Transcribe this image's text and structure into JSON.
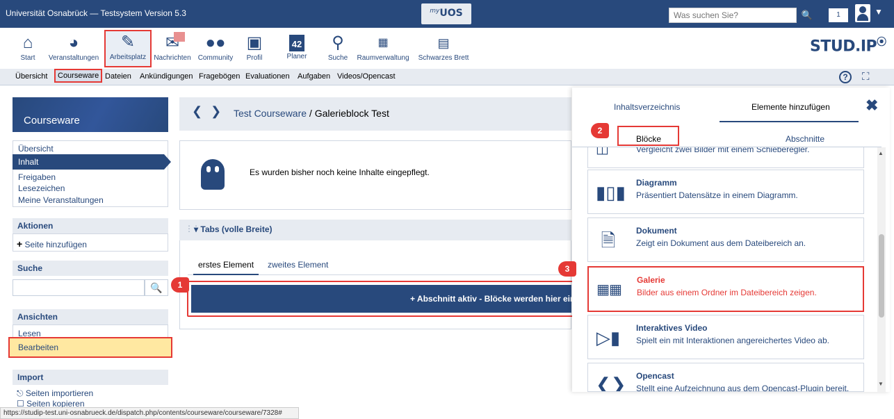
{
  "topbar": {
    "title": "Universität Osnabrück — Testsystem Version 5.3",
    "myuos_prefix": "my",
    "myuos_label": "UOS",
    "search_placeholder": "Was suchen Sie?",
    "counter": "1"
  },
  "nav": {
    "items": [
      {
        "label": "Start",
        "icon": "home-icon"
      },
      {
        "label": "Veranstaltungen",
        "icon": "courses-icon"
      },
      {
        "label": "Arbeitsplatz",
        "icon": "workplace-icon"
      },
      {
        "label": "Nachrichten",
        "icon": "mail-icon"
      },
      {
        "label": "Community",
        "icon": "community-icon"
      },
      {
        "label": "Profil",
        "icon": "profile-icon"
      },
      {
        "label": "Planer",
        "icon": "calendar-icon",
        "badge": "42"
      },
      {
        "label": "Suche",
        "icon": "search-icon"
      },
      {
        "label": "Raumverwaltung",
        "icon": "rooms-icon"
      },
      {
        "label": "Schwarzes Brett",
        "icon": "board-icon"
      }
    ],
    "logo": "STUD.IP"
  },
  "subnav": {
    "items": [
      "Übersicht",
      "Courseware",
      "Dateien",
      "Ankündigungen",
      "Fragebögen",
      "Evaluationen",
      "Aufgaben",
      "Videos/Opencast"
    ]
  },
  "sidebar": {
    "header": "Courseware",
    "nav": [
      "Übersicht",
      "Inhalt",
      "Freigaben",
      "Lesezeichen",
      "Meine Veranstaltungen"
    ],
    "actions_title": "Aktionen",
    "actions": [
      "Seite hinzufügen"
    ],
    "search_title": "Suche",
    "views_title": "Ansichten",
    "views": [
      "Lesen",
      "Bearbeiten"
    ],
    "import_title": "Import",
    "import": [
      "Seiten importieren",
      "Seiten kopieren"
    ]
  },
  "main": {
    "breadcrumb_parent": "Test Courseware",
    "breadcrumb_separator": " / ",
    "breadcrumb_current": "Galerieblock Test",
    "empty_text": "Es wurden bisher noch keine Inhalte eingepflegt.",
    "tabs_title": "Tabs (volle Breite)",
    "tab_first": "erstes Element",
    "tab_second": "zweites Element",
    "active_section": "+ Abschnitt aktiv - Blöcke werden hier einge"
  },
  "panel": {
    "tab_toc": "Inhaltsverzeichnis",
    "tab_add": "Elemente hinzufügen",
    "sub_blocks": "Blöcke",
    "sub_sections": "Abschnitte",
    "partial_top_text": "Vergleicht zwei Bilder mit einem Schieberegler.",
    "blocks": [
      {
        "title": "Diagramm",
        "desc": "Präsentiert Datensätze in einem Diagramm.",
        "icon": "chart-icon"
      },
      {
        "title": "Dokument",
        "desc": "Zeigt ein Dokument aus dem Dateibereich an.",
        "icon": "document-icon"
      },
      {
        "title": "Galerie",
        "desc": "Bilder aus einem Ordner im Dateibereich zeigen.",
        "icon": "gallery-icon"
      },
      {
        "title": "Interaktives Video",
        "desc": "Spielt ein mit Interaktionen angereichertes Video ab.",
        "icon": "video-icon"
      },
      {
        "title": "Opencast",
        "desc": "Stellt eine Aufzeichnung aus dem Opencast-Plugin bereit.",
        "icon": "opencast-icon"
      }
    ]
  },
  "markers": [
    "1",
    "2",
    "3"
  ],
  "statusbar": "https://studip-test.uni-osnabrueck.de/dispatch.php/contents/courseware/courseware/7328#",
  "colors": {
    "primary": "#28497c",
    "highlight": "#e53935",
    "selected": "#ffe8a1"
  }
}
